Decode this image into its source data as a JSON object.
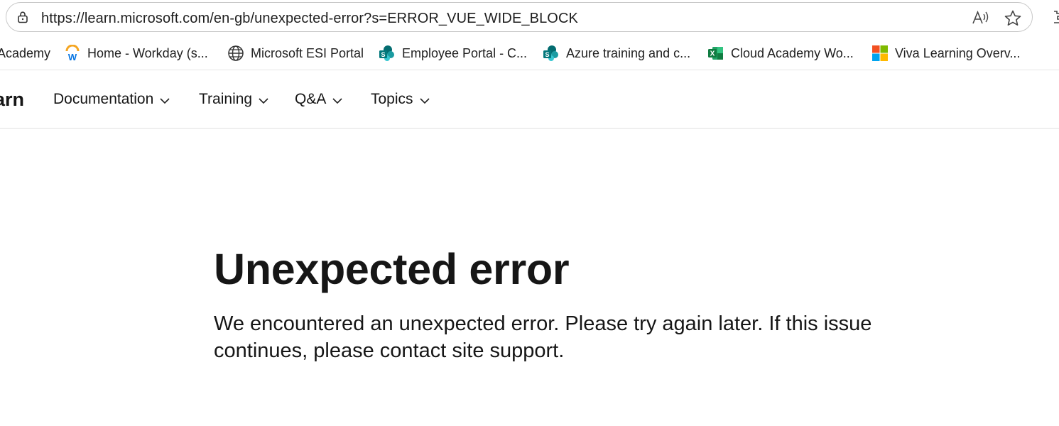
{
  "browser": {
    "url": "https://learn.microsoft.com/en-gb/unexpected-error?s=ERROR_VUE_WIDE_BLOCK",
    "icons": {
      "lock": "lock-icon",
      "read_aloud": "read-aloud-icon",
      "favorite": "star-icon",
      "extensions": "extensions-icon"
    }
  },
  "favorites": [
    {
      "label": "Academy",
      "icon": "none"
    },
    {
      "label": "Home - Workday (s...",
      "icon": "workday-icon"
    },
    {
      "label": "Microsoft ESI Portal",
      "icon": "globe-icon"
    },
    {
      "label": "Employee Portal - C...",
      "icon": "sharepoint-icon"
    },
    {
      "label": "Azure training and c...",
      "icon": "sharepoint-icon"
    },
    {
      "label": "Cloud Academy Wo...",
      "icon": "excel-icon"
    },
    {
      "label": "Viva Learning Overv...",
      "icon": "microsoft-icon"
    }
  ],
  "header": {
    "brand": "arn",
    "nav": [
      {
        "label": "Documentation"
      },
      {
        "label": "Training"
      },
      {
        "label": "Q&A"
      },
      {
        "label": "Topics"
      }
    ]
  },
  "main": {
    "title": "Unexpected error",
    "message": "We encountered an unexpected error. Please try again later. If this issue continues, please contact site support."
  },
  "colors": {
    "text": "#161616",
    "workday_blue": "#0875e1",
    "workday_orange": "#f5a623",
    "excel_green": "#107c41",
    "sharepoint_teal": "#03787c"
  }
}
